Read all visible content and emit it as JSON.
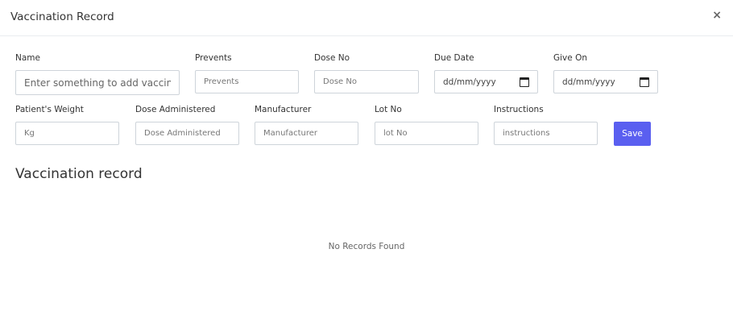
{
  "modal": {
    "title": "Vaccination Record",
    "close_label": "×"
  },
  "form": {
    "name": {
      "label": "Name",
      "placeholder": "Enter something to add vaccine"
    },
    "prevents": {
      "label": "Prevents",
      "placeholder": "Prevents"
    },
    "dose_no": {
      "label": "Dose No",
      "placeholder": "Dose No"
    },
    "due_date": {
      "label": "Due Date",
      "value": "dd/mm/yyyy"
    },
    "give_on": {
      "label": "Give On",
      "value": "dd/mm/yyyy"
    },
    "weight": {
      "label": "Patient's Weight",
      "placeholder": "Kg"
    },
    "dose_administered": {
      "label": "Dose Administered",
      "placeholder": "Dose Administered"
    },
    "manufacturer": {
      "label": "Manufacturer",
      "placeholder": "Manufacturer"
    },
    "lot_no": {
      "label": "Lot No",
      "placeholder": "lot No"
    },
    "instructions": {
      "label": "Instructions",
      "placeholder": "instructions"
    },
    "save_label": "Save"
  },
  "records": {
    "title": "Vaccination record",
    "empty_message": "No Records Found"
  },
  "colors": {
    "accent": "#5a5ff0"
  }
}
